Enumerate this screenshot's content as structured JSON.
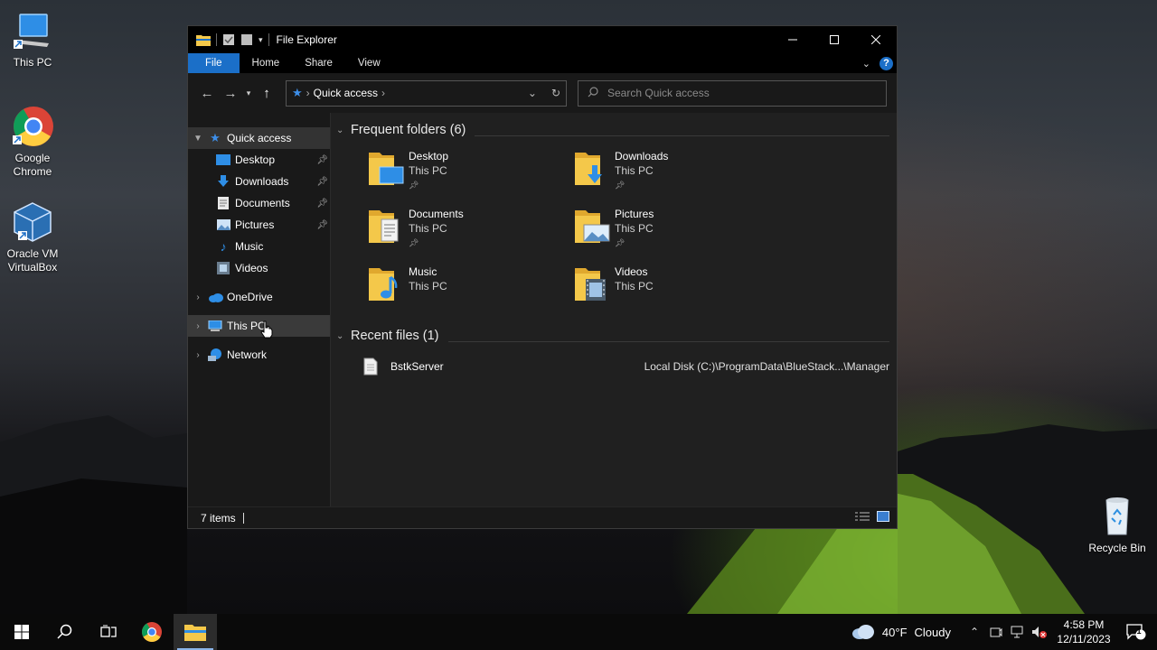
{
  "desktop": {
    "icons": [
      {
        "label": "This PC"
      },
      {
        "label": "Google Chrome"
      },
      {
        "label": "Oracle VM VirtualBox"
      },
      {
        "label": "Recycle Bin"
      }
    ]
  },
  "window": {
    "title": "File Explorer",
    "ribbon_tabs": [
      "File",
      "Home",
      "Share",
      "View"
    ],
    "help_label": "?",
    "address": {
      "root_icon": "quick-access-star",
      "crumb": "Quick access"
    },
    "search": {
      "placeholder": "Search Quick access"
    },
    "sidebar": {
      "quick_access": "Quick access",
      "pinned": [
        {
          "label": "Desktop",
          "pinned": true
        },
        {
          "label": "Downloads",
          "pinned": true
        },
        {
          "label": "Documents",
          "pinned": true
        },
        {
          "label": "Pictures",
          "pinned": true
        },
        {
          "label": "Music",
          "pinned": false
        },
        {
          "label": "Videos",
          "pinned": false
        }
      ],
      "onedrive": "OneDrive",
      "this_pc": "This PC",
      "network": "Network"
    },
    "frequent": {
      "header": "Frequent folders (6)",
      "folders": [
        {
          "name": "Desktop",
          "location": "This PC",
          "pinned": true
        },
        {
          "name": "Downloads",
          "location": "This PC",
          "pinned": true
        },
        {
          "name": "Documents",
          "location": "This PC",
          "pinned": true
        },
        {
          "name": "Pictures",
          "location": "This PC",
          "pinned": true
        },
        {
          "name": "Music",
          "location": "This PC",
          "pinned": false
        },
        {
          "name": "Videos",
          "location": "This PC",
          "pinned": false
        }
      ]
    },
    "recent": {
      "header": "Recent files (1)",
      "files": [
        {
          "name": "BstkServer",
          "path": "Local Disk (C:)\\ProgramData\\BlueStack...\\Manager"
        }
      ]
    },
    "status": {
      "items": "7 items"
    }
  },
  "taskbar": {
    "weather": {
      "temp": "40°F",
      "condition": "Cloudy"
    },
    "time": "4:58 PM",
    "date": "12/11/2023",
    "notification_count": "1"
  },
  "colors": {
    "accent": "#1b6fc8",
    "folder": "#f4c84a",
    "folder_dark": "#e0a82e"
  }
}
